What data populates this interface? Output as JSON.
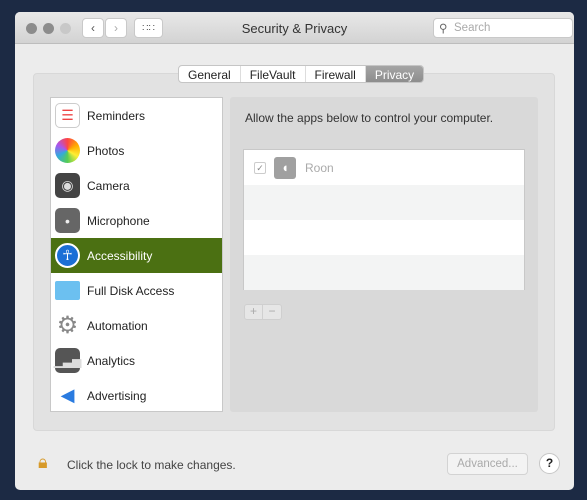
{
  "window": {
    "title": "Security & Privacy",
    "search_placeholder": "Search"
  },
  "tabs": [
    {
      "label": "General"
    },
    {
      "label": "FileVault"
    },
    {
      "label": "Firewall"
    },
    {
      "label": "Privacy",
      "selected": true
    }
  ],
  "sidebar": {
    "items": [
      {
        "label": "Reminders",
        "icon": "reminders-icon"
      },
      {
        "label": "Photos",
        "icon": "photos-icon"
      },
      {
        "label": "Camera",
        "icon": "camera-icon"
      },
      {
        "label": "Microphone",
        "icon": "microphone-icon"
      },
      {
        "label": "Accessibility",
        "icon": "accessibility-icon",
        "selected": true
      },
      {
        "label": "Full Disk Access",
        "icon": "folder-icon"
      },
      {
        "label": "Automation",
        "icon": "gear-icon"
      },
      {
        "label": "Analytics",
        "icon": "analytics-icon"
      },
      {
        "label": "Advertising",
        "icon": "megaphone-icon"
      }
    ]
  },
  "main": {
    "message": "Allow the apps below to control your computer.",
    "apps": [
      {
        "name": "Roon",
        "checked": true
      }
    ],
    "add": "+",
    "remove": "−"
  },
  "footer": {
    "lock_text": "Click the lock to make changes.",
    "advanced": "Advanced...",
    "help": "?"
  },
  "colors": {
    "selection": "#4b7012"
  }
}
